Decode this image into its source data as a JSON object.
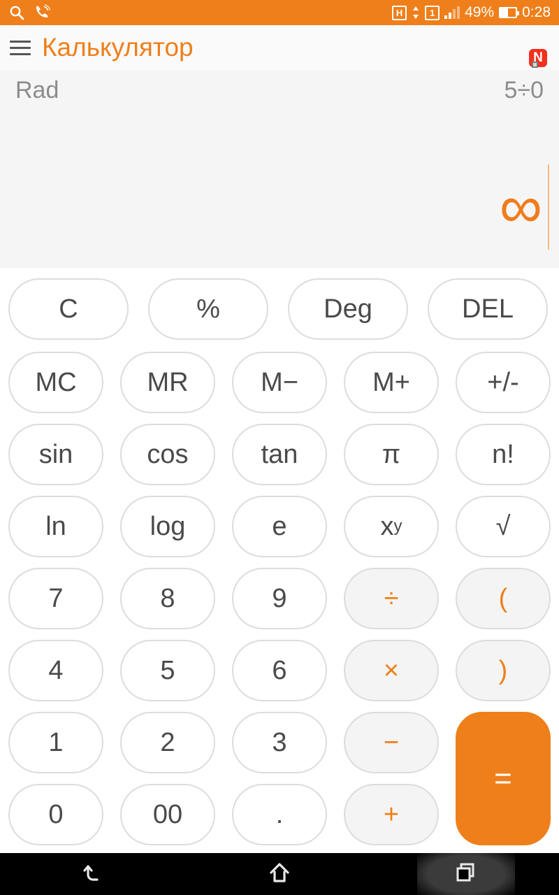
{
  "statusbar": {
    "left_icons": [
      {
        "name": "search-icon",
        "label": "search"
      },
      {
        "name": "call-sound-icon",
        "label": "call"
      }
    ],
    "network_type": "H",
    "sim_indicator": "1",
    "battery_percent": "49%",
    "time": "0:28",
    "accent": "#ef7f1a"
  },
  "appbar": {
    "menu_icon": "hamburger-icon",
    "title": "Калькулятор",
    "overflow_icon": "overflow-menu-icon",
    "badge": "N",
    "badge_color": "#f4301e",
    "title_color": "#ef7f1a"
  },
  "display": {
    "angle_mode": "Rad",
    "expression": "5÷0",
    "result": "∞",
    "result_color": "#f07c1b",
    "background": "#f5f5f5"
  },
  "keypad": {
    "rows": [
      {
        "keys": [
          {
            "label": "C",
            "name": "key-clear",
            "style": "plain"
          },
          {
            "label": "%",
            "name": "key-percent",
            "style": "plain"
          },
          {
            "label": "Deg",
            "name": "key-deg",
            "style": "plain"
          },
          {
            "label": "DEL",
            "name": "key-del",
            "style": "plain"
          }
        ]
      },
      {
        "keys": [
          {
            "label": "MC",
            "name": "key-mc",
            "style": "plain"
          },
          {
            "label": "MR",
            "name": "key-mr",
            "style": "plain"
          },
          {
            "label": "M−",
            "name": "key-m-minus",
            "style": "plain"
          },
          {
            "label": "M+",
            "name": "key-m-plus",
            "style": "plain"
          },
          {
            "label": "+/-",
            "name": "key-sign",
            "style": "plain"
          }
        ]
      },
      {
        "keys": [
          {
            "label": "sin",
            "name": "key-sin",
            "style": "plain"
          },
          {
            "label": "cos",
            "name": "key-cos",
            "style": "plain"
          },
          {
            "label": "tan",
            "name": "key-tan",
            "style": "plain"
          },
          {
            "label": "π",
            "name": "key-pi",
            "style": "plain"
          },
          {
            "label": "n!",
            "name": "key-factorial",
            "style": "plain"
          }
        ]
      },
      {
        "keys": [
          {
            "label": "ln",
            "name": "key-ln",
            "style": "plain"
          },
          {
            "label": "log",
            "name": "key-log",
            "style": "plain"
          },
          {
            "label": "e",
            "name": "key-e",
            "style": "plain"
          },
          {
            "label": "x^y",
            "name": "key-power",
            "style": "plain",
            "sup": true,
            "base": "x",
            "exp": "y"
          },
          {
            "label": "√",
            "name": "key-sqrt",
            "style": "plain"
          }
        ]
      },
      {
        "keys": [
          {
            "label": "7",
            "name": "key-7",
            "style": "plain"
          },
          {
            "label": "8",
            "name": "key-8",
            "style": "plain"
          },
          {
            "label": "9",
            "name": "key-9",
            "style": "plain"
          },
          {
            "label": "÷",
            "name": "key-divide",
            "style": "op"
          },
          {
            "label": "(",
            "name": "key-paren-open",
            "style": "op"
          }
        ]
      },
      {
        "keys": [
          {
            "label": "4",
            "name": "key-4",
            "style": "plain"
          },
          {
            "label": "5",
            "name": "key-5",
            "style": "plain"
          },
          {
            "label": "6",
            "name": "key-6",
            "style": "plain"
          },
          {
            "label": "×",
            "name": "key-multiply",
            "style": "op"
          },
          {
            "label": ")",
            "name": "key-paren-close",
            "style": "op"
          }
        ]
      },
      {
        "keys": [
          {
            "label": "1",
            "name": "key-1",
            "style": "plain"
          },
          {
            "label": "2",
            "name": "key-2",
            "style": "plain"
          },
          {
            "label": "3",
            "name": "key-3",
            "style": "plain"
          },
          {
            "label": "−",
            "name": "key-minus",
            "style": "op"
          },
          {
            "label": "=",
            "name": "key-equals",
            "style": "eq"
          }
        ]
      },
      {
        "keys": [
          {
            "label": "0",
            "name": "key-0",
            "style": "plain"
          },
          {
            "label": "00",
            "name": "key-double-zero",
            "style": "plain"
          },
          {
            "label": ".",
            "name": "key-decimal",
            "style": "plain"
          },
          {
            "label": "+",
            "name": "key-plus",
            "style": "op"
          }
        ]
      }
    ]
  },
  "navbar": {
    "buttons": [
      {
        "name": "nav-back-button",
        "icon": "back-arrow-icon",
        "active": false
      },
      {
        "name": "nav-home-button",
        "icon": "home-icon",
        "active": false
      },
      {
        "name": "nav-recents-button",
        "icon": "recents-icon",
        "active": true
      }
    ]
  }
}
